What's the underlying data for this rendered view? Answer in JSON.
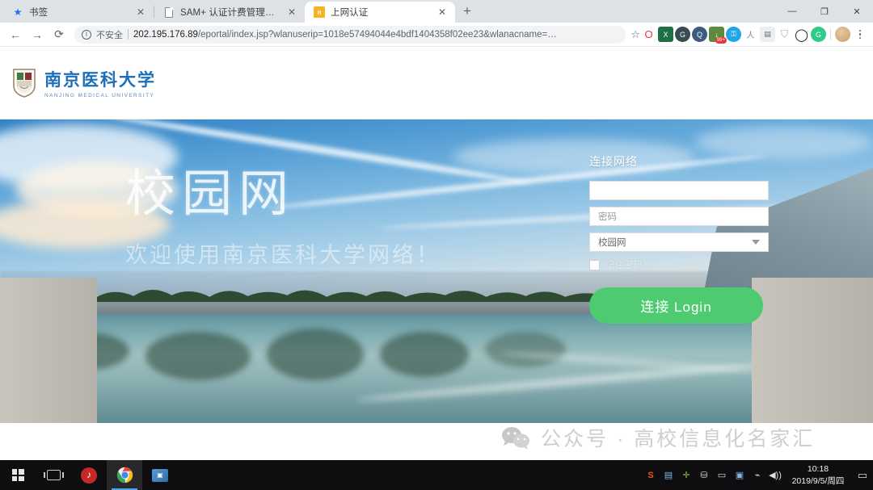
{
  "browser": {
    "tabs": [
      {
        "title": "书签",
        "favicon": "star-icon",
        "active": false
      },
      {
        "title": "SAM+ 认证计费管理平台",
        "favicon": "document-icon",
        "active": false
      },
      {
        "title": "上网认证",
        "favicon": "portal-icon",
        "active": true
      }
    ],
    "new_tab_label": "+",
    "close_label": "✕",
    "window_controls": {
      "minimize": "—",
      "maximize": "❐",
      "close": "✕"
    },
    "nav": {
      "back": "←",
      "forward": "→",
      "reload": "⟳"
    },
    "omnibox": {
      "security_icon": "info-icon",
      "security_label": "不安全",
      "url_host": "202.195.176.89",
      "url_path": "/eportal/index.jsp?wlanuserip=1018e57494044e4bdf1404358f02ee23&wlanacname=…",
      "bookmark_icon": "☆"
    },
    "extensions": [
      {
        "name": "opera-extension",
        "glyph": "O",
        "color": "#e03a3e",
        "bg": "#ffffff",
        "shape": "round"
      },
      {
        "name": "excel-download-extension",
        "glyph": "X",
        "color": "#ffffff",
        "bg": "#1d7044",
        "shape": "square"
      },
      {
        "name": "grammar-extension",
        "glyph": "G",
        "color": "#ffffff",
        "bg": "#3b4b54",
        "shape": "round"
      },
      {
        "name": "qq-extension",
        "glyph": "Q",
        "color": "#ffffff",
        "bg": "#3d5a80",
        "shape": "round"
      },
      {
        "name": "downloader-extension",
        "glyph": "↓",
        "color": "#ffffff",
        "bg": "#5c8a3f",
        "shape": "square",
        "badge": "99+"
      },
      {
        "name": "key-extension",
        "glyph": "⚿",
        "color": "#ffffff",
        "bg": "#21a5e8",
        "shape": "round"
      },
      {
        "name": "runner-extension",
        "glyph": "人",
        "color": "#7b8a95",
        "bg": "#ffffff",
        "shape": "round"
      },
      {
        "name": "print-extension",
        "glyph": "▤",
        "color": "#5b6a77",
        "bg": "#eceff1",
        "shape": "square"
      },
      {
        "name": "shield-extension",
        "glyph": "🛡",
        "color": "#9aa5ad",
        "bg": "#ffffff",
        "shape": "round"
      },
      {
        "name": "ring-extension",
        "glyph": "◯",
        "color": "#111111",
        "bg": "#ffffff",
        "shape": "round"
      },
      {
        "name": "grammarly-extension",
        "glyph": "G",
        "color": "#ffffff",
        "bg": "#2ecb8a",
        "shape": "round"
      }
    ]
  },
  "site": {
    "logo": {
      "crest_alt": "university-crest",
      "name_cn": "南京医科大学",
      "name_en": "NANJING MEDICAL UNIVERSITY",
      "brand_color": "#1c6fb8"
    },
    "hero": {
      "title": "校园网",
      "subtitle": "欢迎使用南京医科大学网络！"
    },
    "login": {
      "heading": "连接网络",
      "username": {
        "value": "",
        "placeholder": ""
      },
      "password": {
        "value": "",
        "placeholder": "密码"
      },
      "network": {
        "selected": "校园网",
        "options": [
          "校园网"
        ]
      },
      "remember": {
        "label": "记住密码",
        "checked": false
      },
      "submit_label": "连接 Login",
      "submit_color": "#4ecb71"
    },
    "watermark": {
      "icon": "wechat-icon",
      "text": "公众号 · 高校信息化名家汇"
    }
  },
  "taskbar": {
    "start_label": "start-button",
    "items": [
      {
        "name": "start-button",
        "glyph": ""
      },
      {
        "name": "task-view-button",
        "glyph": ""
      },
      {
        "name": "netease-music-app",
        "glyph": "♫"
      },
      {
        "name": "chrome-app",
        "glyph": ""
      },
      {
        "name": "remote-desktop-app",
        "glyph": "▣"
      }
    ],
    "tray": [
      {
        "name": "sogou-input-icon",
        "glyph": "S",
        "color": "#e8542a"
      },
      {
        "name": "monitor-icon",
        "glyph": "🖵",
        "color": "#7fb8e6"
      },
      {
        "name": "update-icon",
        "glyph": "✛",
        "color": "#8dc63f"
      },
      {
        "name": "usb-icon",
        "glyph": "⛁",
        "color": "#cfcfcf"
      },
      {
        "name": "battery-icon",
        "glyph": "▭",
        "color": "#cfcfcf"
      },
      {
        "name": "display-icon",
        "glyph": "▣",
        "color": "#7fb8e6"
      },
      {
        "name": "network-icon",
        "glyph": "🖧",
        "color": "#cfcfcf"
      },
      {
        "name": "volume-icon",
        "glyph": "🔊",
        "color": "#cfcfcf"
      }
    ],
    "clock": {
      "time": "10:18",
      "date": "2019/9/5/周四"
    },
    "notification_glyph": "▭"
  }
}
